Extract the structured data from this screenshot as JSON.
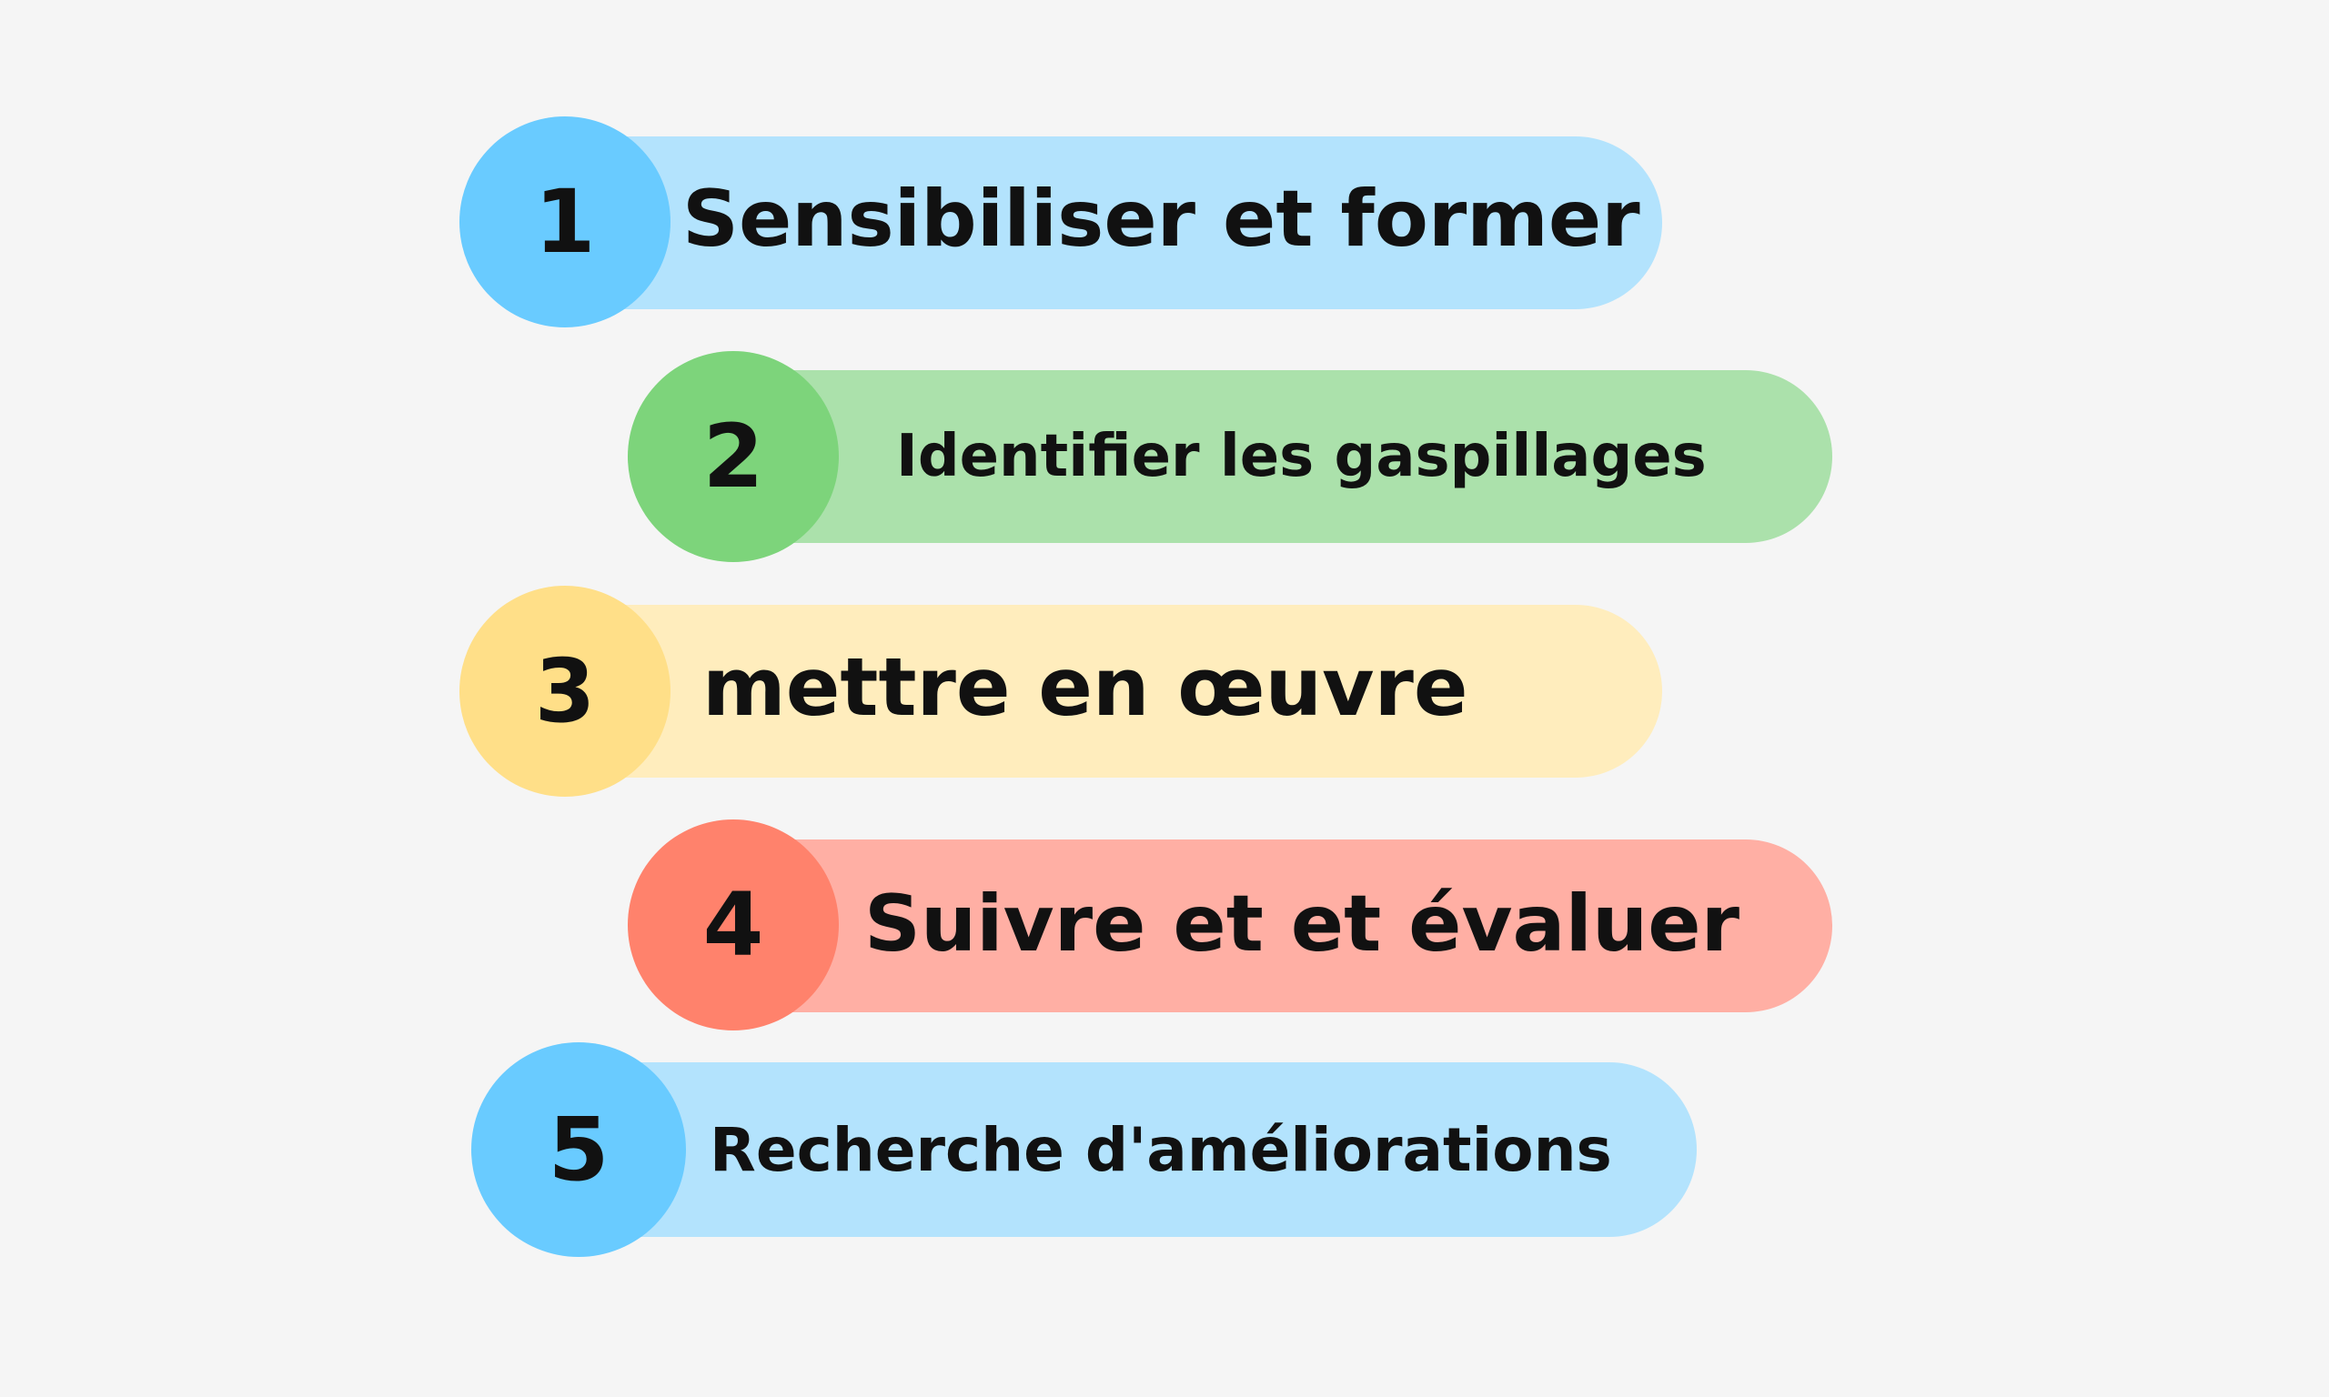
{
  "steps": [
    {
      "number": "1",
      "label": "Sensibiliser et former",
      "pill_color": "#b3e3fd",
      "circle_color": "#69cbff"
    },
    {
      "number": "2",
      "label": "Identifier les gaspillages",
      "pill_color": "#abe1ab",
      "circle_color": "#7dd47b"
    },
    {
      "number": "3",
      "label": "mettre en œuvre",
      "pill_color": "#ffedbd",
      "circle_color": "#ffdf88"
    },
    {
      "number": "4",
      "label": "Suivre et et évaluer",
      "pill_color": "#ffafa4",
      "circle_color": "#ff826c"
    },
    {
      "number": "5",
      "label": "Recherche d'améliorations",
      "pill_color": "#b3e3fd",
      "circle_color": "#69cbff"
    }
  ]
}
